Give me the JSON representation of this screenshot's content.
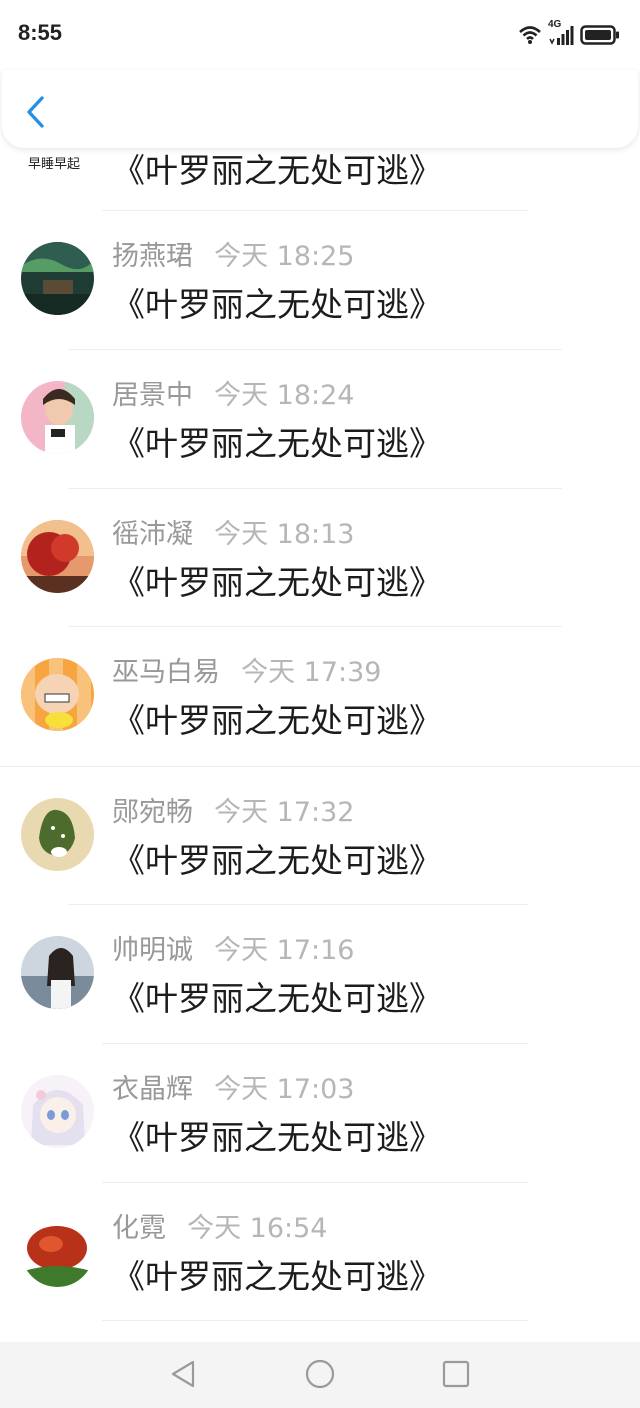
{
  "status_bar": {
    "time": "8:55",
    "network": "4G",
    "icons": [
      "wifi-icon",
      "signal-icon",
      "battery-icon"
    ]
  },
  "header": {
    "back_icon": "chevron-left-icon",
    "accent": "#2a8fe0"
  },
  "top_partial": {
    "avatar_text": "早睡早起",
    "message": "《叶罗丽之无处可逃》"
  },
  "comments": [
    {
      "name": "扬燕珺",
      "time": "今天 18:25",
      "message": "《叶罗丽之无处可逃》"
    },
    {
      "name": "居景中",
      "time": "今天 18:24",
      "message": "《叶罗丽之无处可逃》"
    },
    {
      "name": "徭沛凝",
      "time": "今天 18:13",
      "message": "《叶罗丽之无处可逃》"
    },
    {
      "name": "巫马白易",
      "time": "今天 17:39",
      "message": "《叶罗丽之无处可逃》"
    },
    {
      "name": "郧宛畅",
      "time": "今天 17:32",
      "message": "《叶罗丽之无处可逃》"
    },
    {
      "name": "帅明诚",
      "time": "今天 17:16",
      "message": "《叶罗丽之无处可逃》"
    },
    {
      "name": "衣晶辉",
      "time": "今天 17:03",
      "message": "《叶罗丽之无处可逃》"
    },
    {
      "name": "化霓",
      "time": "今天 16:54",
      "message": "《叶罗丽之无处可逃》"
    }
  ],
  "nav": {
    "back": "triangle-back-icon",
    "home": "circle-home-icon",
    "recents": "square-recents-icon"
  }
}
